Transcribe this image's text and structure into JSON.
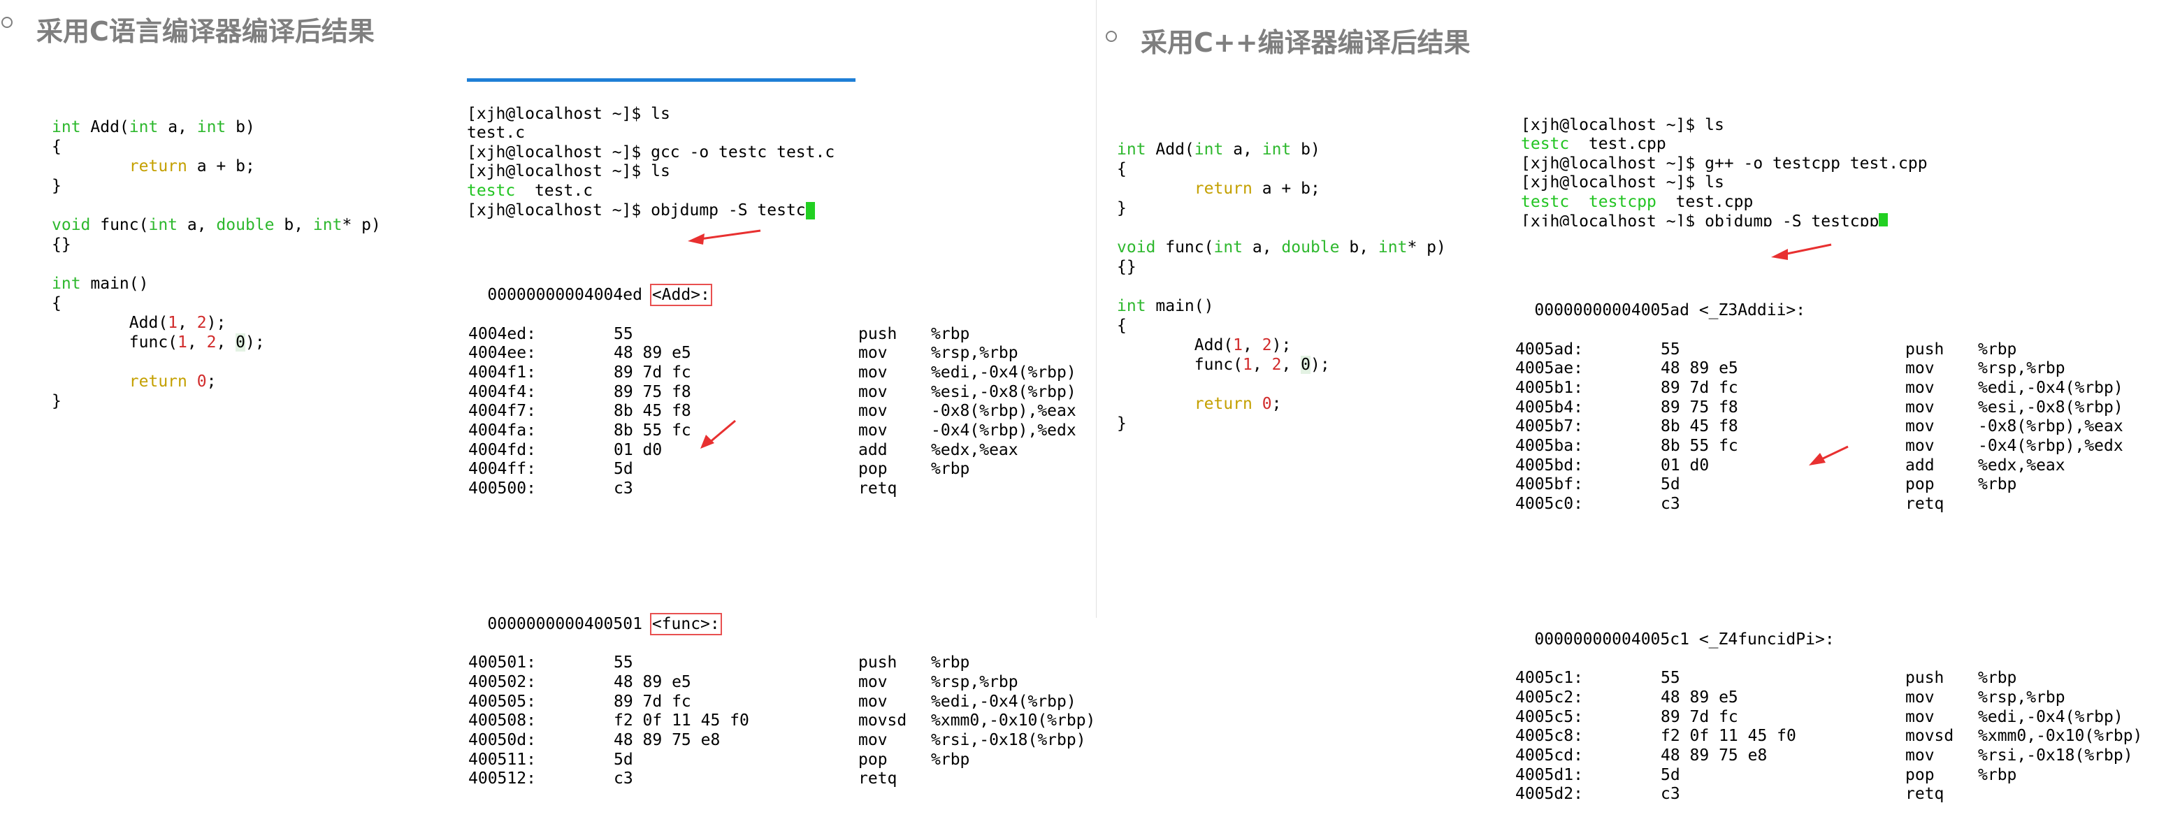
{
  "left": {
    "title": "采用C语言编译器编译后结果",
    "source": [
      "int Add(int a, int b)",
      "{",
      "        return a + b;",
      "}",
      "",
      "void func(int a, double b, int* p)",
      "{}",
      "",
      "int main()",
      "{",
      "        Add(1, 2);",
      "        func(1, 2, 0);",
      "",
      "        return 0;",
      "}"
    ],
    "terminal": {
      "line1": "[xjh@localhost ~]$ ls",
      "line2": "test.c",
      "line3": "[xjh@localhost ~]$ gcc -o testc test.c",
      "line4": "[xjh@localhost ~]$ ls",
      "line5_exe": "testc",
      "line5_src": "test.c",
      "line6": "[xjh@localhost ~]$ objdump -S testc"
    },
    "blocks": [
      {
        "address": "00000000004004ed",
        "label": "<Add>:",
        "rows": [
          [
            "4004ed:",
            "55",
            "push",
            "%rbp"
          ],
          [
            "4004ee:",
            "48 89 e5",
            "mov",
            "%rsp,%rbp"
          ],
          [
            "4004f1:",
            "89 7d fc",
            "mov",
            "%edi,-0x4(%rbp)"
          ],
          [
            "4004f4:",
            "89 75 f8",
            "mov",
            "%esi,-0x8(%rbp)"
          ],
          [
            "4004f7:",
            "8b 45 f8",
            "mov",
            "-0x8(%rbp),%eax"
          ],
          [
            "4004fa:",
            "8b 55 fc",
            "mov",
            "-0x4(%rbp),%edx"
          ],
          [
            "4004fd:",
            "01 d0",
            "add",
            "%edx,%eax"
          ],
          [
            "4004ff:",
            "5d",
            "pop",
            "%rbp"
          ],
          [
            "400500:",
            "c3",
            "retq",
            ""
          ]
        ]
      },
      {
        "address": "0000000000400501",
        "label": "<func>:",
        "rows": [
          [
            "400501:",
            "55",
            "push",
            "%rbp"
          ],
          [
            "400502:",
            "48 89 e5",
            "mov",
            "%rsp,%rbp"
          ],
          [
            "400505:",
            "89 7d fc",
            "mov",
            "%edi,-0x4(%rbp)"
          ],
          [
            "400508:",
            "f2 0f 11 45 f0",
            "movsd",
            "%xmm0,-0x10(%rbp)"
          ],
          [
            "40050d:",
            "48 89 75 e8",
            "mov",
            "%rsi,-0x18(%rbp)"
          ],
          [
            "400511:",
            "5d",
            "pop",
            "%rbp"
          ],
          [
            "400512:",
            "c3",
            "retq",
            ""
          ]
        ]
      }
    ]
  },
  "right": {
    "title": "采用C++编译器编译后结果",
    "source": [
      "int Add(int a, int b)",
      "{",
      "        return a + b;",
      "}",
      "",
      "void func(int a, double b, int* p)",
      "{}",
      "",
      "int main()",
      "{",
      "        Add(1, 2);",
      "        func(1, 2, 0);",
      "",
      "        return 0;",
      "}"
    ],
    "terminal": {
      "line0": "[xjh@localhost ~]$ ls",
      "line1_exe": "testc",
      "line1_src": "test.cpp",
      "line2": "[xjh@localhost ~]$ g++ -o testcpp test.cpp",
      "line3": "[xjh@localhost ~]$ ls",
      "line4_exe1": "testc",
      "line4_exe2": "testcpp",
      "line4_src": "test.cpp",
      "line5": "[xjh@localhost ~]$ objdump -S testcpp"
    },
    "blocks": [
      {
        "address": "00000000004005ad",
        "label": "<_Z3Addii>:",
        "rows": [
          [
            "4005ad:",
            "55",
            "push",
            "%rbp"
          ],
          [
            "4005ae:",
            "48 89 e5",
            "mov",
            "%rsp,%rbp"
          ],
          [
            "4005b1:",
            "89 7d fc",
            "mov",
            "%edi,-0x4(%rbp)"
          ],
          [
            "4005b4:",
            "89 75 f8",
            "mov",
            "%esi,-0x8(%rbp)"
          ],
          [
            "4005b7:",
            "8b 45 f8",
            "mov",
            "-0x8(%rbp),%eax"
          ],
          [
            "4005ba:",
            "8b 55 fc",
            "mov",
            "-0x4(%rbp),%edx"
          ],
          [
            "4005bd:",
            "01 d0",
            "add",
            "%edx,%eax"
          ],
          [
            "4005bf:",
            "5d",
            "pop",
            "%rbp"
          ],
          [
            "4005c0:",
            "c3",
            "retq",
            ""
          ]
        ]
      },
      {
        "address": "00000000004005c1",
        "label": "<_Z4funcidPi>:",
        "rows": [
          [
            "4005c1:",
            "55",
            "push",
            "%rbp"
          ],
          [
            "4005c2:",
            "48 89 e5",
            "mov",
            "%rsp,%rbp"
          ],
          [
            "4005c5:",
            "89 7d fc",
            "mov",
            "%edi,-0x4(%rbp)"
          ],
          [
            "4005c8:",
            "f2 0f 11 45 f0",
            "movsd",
            "%xmm0,-0x10(%rbp)"
          ],
          [
            "4005cd:",
            "48 89 75 e8",
            "mov",
            "%rsi,-0x18(%rbp)"
          ],
          [
            "4005d1:",
            "5d",
            "pop",
            "%rbp"
          ],
          [
            "4005d2:",
            "c3",
            "retq",
            ""
          ]
        ]
      }
    ]
  },
  "colors": {
    "keyword": "#2eb82e",
    "return": "#c4a000",
    "number": "#d12b2b",
    "arrow": "#e83030",
    "heading": "#7f7f7f"
  }
}
